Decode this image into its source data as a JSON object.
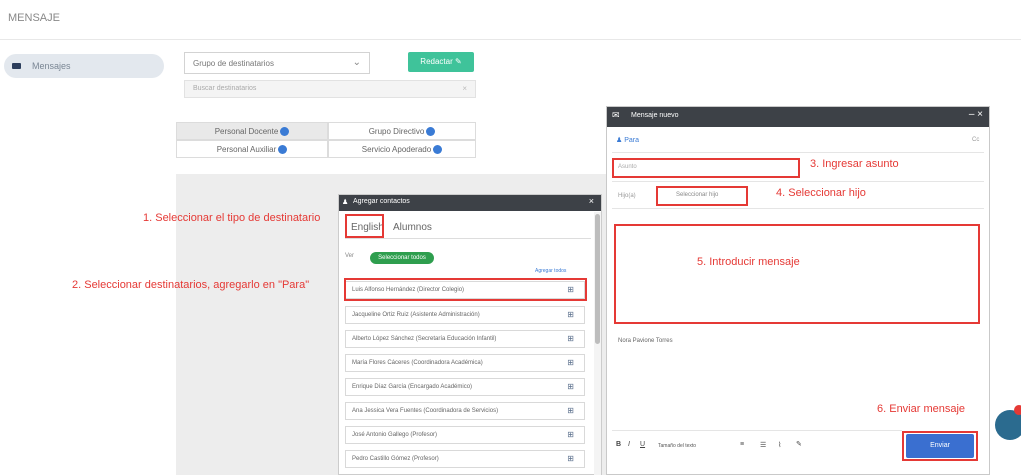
{
  "topbar": {
    "title": "MENSAJE"
  },
  "sidebar": {
    "item_label": "Mensajes"
  },
  "compose_form": {
    "destination_type_value": "Grupo de destinatarios",
    "new_button_label": "Redactar",
    "search_placeholder": "Buscar destinatarios",
    "categories": [
      {
        "label": "Personal Docente"
      },
      {
        "label": "Grupo Directivo"
      },
      {
        "label": "Personal Auxiliar"
      },
      {
        "label": "Servicio Apoderado"
      }
    ]
  },
  "annotations": {
    "step1": "1. Seleccionar el tipo de destinatario",
    "step2": "2. Seleccionar destinatarios, agregarlo en \"Para\"",
    "step3": "3. Ingresar asunto",
    "step4": "4. Seleccionar hijo",
    "step5": "5. Introducir mensaje",
    "step6": "6. Enviar mensaje"
  },
  "recipients_panel": {
    "title": "Agregar contactos",
    "tabs": [
      "English",
      "Alumnos"
    ],
    "filter_prefix": "Ver",
    "filter_pill": "Seleccionar todos",
    "add_all_link": "Agregar todos",
    "rows": [
      "Luis Alfonso Hernández (Director Colegio)",
      "Jacqueline Ortiz Ruiz (Asistente Administración)",
      "Alberto López Sánchez (Secretaría Educación Infantil)",
      "María Flores Cáceres (Coordinadora Académica)",
      "Enrique Díaz García (Encargado Académico)",
      "Ana Jessica Vera Fuentes (Coordinadora de Servicios)",
      "José Antonio Gallego (Profesor)",
      "Pedro Castillo Gómez (Profesor)"
    ]
  },
  "message_panel": {
    "title": "Mensaje nuevo",
    "to_label": "Para",
    "cc_label": "Cc",
    "subject_placeholder": "Asunto",
    "child_label": "Hijo(a)",
    "child_value": "Seleccionar hijo",
    "signature": "Nora Pavione Torres",
    "toolbar_font": "Tamaño del texto",
    "send_label": "Enviar"
  }
}
